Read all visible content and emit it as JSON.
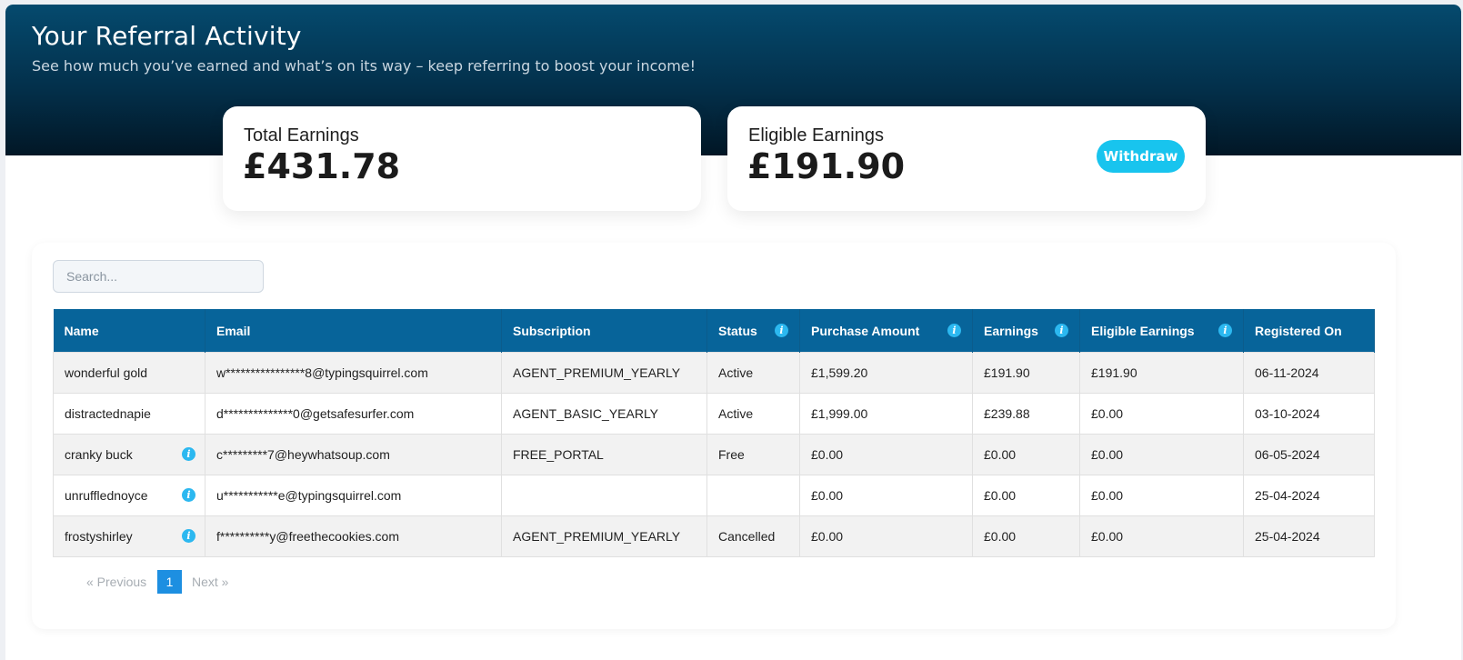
{
  "header": {
    "title": "Your Referral Activity",
    "subtitle": "See how much you’ve earned and what’s on its way – keep referring to boost your income!"
  },
  "cards": {
    "total": {
      "label": "Total Earnings",
      "value": "£431.78"
    },
    "eligible": {
      "label": "Eligible Earnings",
      "value": "£191.90",
      "button": "Withdraw"
    }
  },
  "search": {
    "placeholder": "Search...",
    "value": ""
  },
  "colors": {
    "header_dark": "#021726",
    "header_light": "#054a6e",
    "table_header": "#07649a",
    "accent": "#18c4ee",
    "info_icon": "#2cb8f0"
  },
  "table": {
    "columns": [
      "Name",
      "Email",
      "Subscription",
      "Status",
      "Purchase Amount",
      "Earnings",
      "Eligible Earnings",
      "Registered On"
    ],
    "rows": [
      {
        "name": "wonderful gold",
        "email": "w****************8@typingsquirrel.com",
        "subscription": "AGENT_PREMIUM_YEARLY",
        "status": "Active",
        "purchase": "£1,599.20",
        "earnings": "£191.90",
        "eligible": "£191.90",
        "registered": "06-11-2024"
      },
      {
        "name": "distractednapie",
        "email": "d**************0@getsafesurfer.com",
        "subscription": "AGENT_BASIC_YEARLY",
        "status": "Active",
        "purchase": "£1,999.00",
        "earnings": "£239.88",
        "eligible": "£0.00",
        "registered": "03-10-2024"
      },
      {
        "name": "cranky buck",
        "email": "c*********7@heywhatsoup.com",
        "subscription": "FREE_PORTAL",
        "status": "Free",
        "purchase": "£0.00",
        "earnings": "£0.00",
        "eligible": "£0.00",
        "registered": "06-05-2024"
      },
      {
        "name": "unrufflednoyce",
        "email": "u***********e@typingsquirrel.com",
        "subscription": "",
        "status": "",
        "purchase": "£0.00",
        "earnings": "£0.00",
        "eligible": "£0.00",
        "registered": "25-04-2024"
      },
      {
        "name": "frostyshirley",
        "email": "f**********y@freethecookies.com",
        "subscription": "AGENT_PREMIUM_YEARLY",
        "status": "Cancelled",
        "purchase": "£0.00",
        "earnings": "£0.00",
        "eligible": "£0.00",
        "registered": "25-04-2024"
      }
    ]
  },
  "pagination": {
    "previous": "«  Previous",
    "current": "1",
    "next": "Next  »"
  }
}
